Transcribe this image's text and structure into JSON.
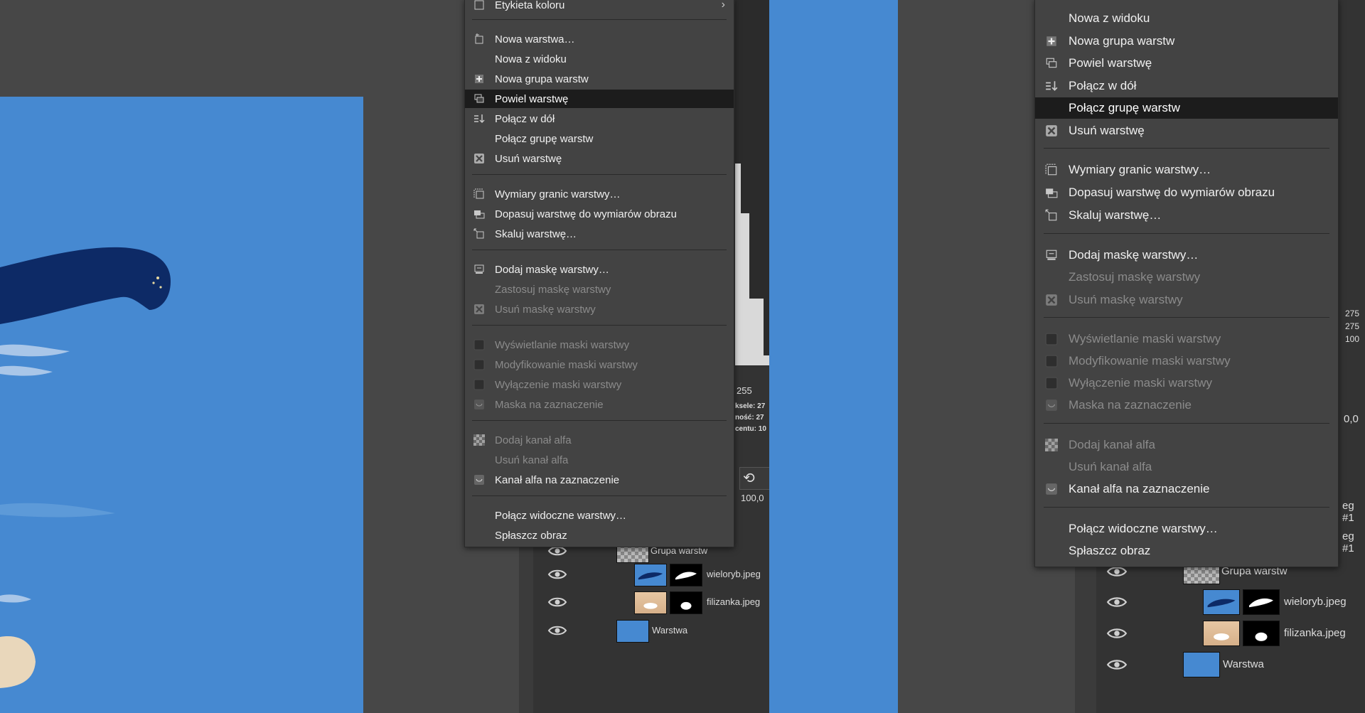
{
  "menu_left": {
    "items": [
      {
        "label": "Etykieta koloru",
        "icon": "color-tag-icon",
        "state": "normal",
        "submenu": true
      },
      {
        "label": "Nowa warstwa…",
        "icon": "new-layer-icon",
        "state": "normal"
      },
      {
        "label": "Nowa z widoku",
        "icon": "",
        "state": "normal"
      },
      {
        "label": "Nowa grupa warstw",
        "icon": "new-group-icon",
        "state": "normal"
      },
      {
        "label": "Powiel warstwę",
        "icon": "duplicate-icon",
        "state": "highlighted"
      },
      {
        "label": "Połącz w dół",
        "icon": "merge-down-icon",
        "state": "normal"
      },
      {
        "label": "Połącz grupę warstw",
        "icon": "",
        "state": "normal"
      },
      {
        "label": "Usuń warstwę",
        "icon": "delete-icon",
        "state": "normal"
      },
      {
        "label": "Wymiary granic warstwy…",
        "icon": "boundary-size-icon",
        "state": "normal"
      },
      {
        "label": "Dopasuj warstwę do wymiarów obrazu",
        "icon": "layer-to-image-icon",
        "state": "normal"
      },
      {
        "label": "Skaluj warstwę…",
        "icon": "scale-layer-icon",
        "state": "normal"
      },
      {
        "label": "Dodaj maskę warstwy…",
        "icon": "add-mask-icon",
        "state": "normal"
      },
      {
        "label": "Zastosuj maskę warstwy",
        "icon": "",
        "state": "disabled"
      },
      {
        "label": "Usuń maskę warstwy",
        "icon": "delete-icon",
        "state": "disabled"
      },
      {
        "label": "Wyświetlanie maski warstwy",
        "icon": "checkbox",
        "state": "disabled"
      },
      {
        "label": "Modyfikowanie maski warstwy",
        "icon": "checkbox",
        "state": "disabled"
      },
      {
        "label": "Wyłączenie maski warstwy",
        "icon": "checkbox",
        "state": "disabled"
      },
      {
        "label": "Maska na zaznaczenie",
        "icon": "mask-selection-icon",
        "state": "disabled"
      },
      {
        "label": "Dodaj kanał alfa",
        "icon": "alpha-icon",
        "state": "disabled"
      },
      {
        "label": "Usuń kanał alfa",
        "icon": "",
        "state": "disabled"
      },
      {
        "label": "Kanał alfa na zaznaczenie",
        "icon": "mask-selection-icon",
        "state": "normal"
      },
      {
        "label": "Połącz widoczne warstwy…",
        "icon": "",
        "state": "normal"
      },
      {
        "label": "Spłaszcz obraz",
        "icon": "",
        "state": "normal"
      }
    ]
  },
  "menu_right": {
    "items": [
      {
        "label": "Nowa z widoku",
        "icon": "",
        "state": "normal"
      },
      {
        "label": "Nowa grupa warstw",
        "icon": "new-group-icon",
        "state": "normal"
      },
      {
        "label": "Powiel warstwę",
        "icon": "duplicate-icon",
        "state": "normal"
      },
      {
        "label": "Połącz w dół",
        "icon": "merge-down-icon",
        "state": "normal"
      },
      {
        "label": "Połącz grupę warstw",
        "icon": "",
        "state": "highlighted"
      },
      {
        "label": "Usuń warstwę",
        "icon": "delete-icon",
        "state": "normal"
      },
      {
        "label": "Wymiary granic warstwy…",
        "icon": "boundary-size-icon",
        "state": "normal"
      },
      {
        "label": "Dopasuj warstwę do wymiarów obrazu",
        "icon": "layer-to-image-icon",
        "state": "normal"
      },
      {
        "label": "Skaluj warstwę…",
        "icon": "scale-layer-icon",
        "state": "normal"
      },
      {
        "label": "Dodaj maskę warstwy…",
        "icon": "add-mask-icon",
        "state": "normal"
      },
      {
        "label": "Zastosuj maskę warstwy",
        "icon": "",
        "state": "disabled"
      },
      {
        "label": "Usuń maskę warstwy",
        "icon": "delete-icon",
        "state": "disabled"
      },
      {
        "label": "Wyświetlanie maski warstwy",
        "icon": "checkbox",
        "state": "disabled"
      },
      {
        "label": "Modyfikowanie maski warstwy",
        "icon": "checkbox",
        "state": "disabled"
      },
      {
        "label": "Wyłączenie maski warstwy",
        "icon": "checkbox",
        "state": "disabled"
      },
      {
        "label": "Maska na zaznaczenie",
        "icon": "mask-selection-icon",
        "state": "disabled"
      },
      {
        "label": "Dodaj kanał alfa",
        "icon": "alpha-icon",
        "state": "disabled"
      },
      {
        "label": "Usuń kanał alfa",
        "icon": "",
        "state": "disabled"
      },
      {
        "label": "Kanał alfa na zaznaczenie",
        "icon": "mask-selection-icon",
        "state": "normal"
      },
      {
        "label": "Połącz widoczne warstwy…",
        "icon": "",
        "state": "normal"
      },
      {
        "label": "Spłaszcz obraz",
        "icon": "",
        "state": "normal"
      }
    ]
  },
  "histogram": {
    "max_value": "255"
  },
  "pointer_info": {
    "label_1": "ksele:",
    "value_1": "27",
    "label_2": "ność:",
    "value_2": "27",
    "label_3": "centu:",
    "value_3": "10"
  },
  "pointer_info_right": {
    "value_1": "275",
    "value_2": "275",
    "value_3": "100"
  },
  "opacity_left": "100,0",
  "opacity_right": "0,0",
  "layers_left": [
    {
      "name": "Grupa warstw",
      "kind": "group"
    },
    {
      "name": "wieloryb.jpeg",
      "kind": "whale"
    },
    {
      "name": "filizanka.jpeg",
      "kind": "cup"
    },
    {
      "name": "Warstwa",
      "kind": "solid"
    }
  ],
  "layers_right": [
    {
      "name": "Grupa warstw",
      "kind": "group"
    },
    {
      "name": "wieloryb.jpeg",
      "kind": "whale"
    },
    {
      "name": "filizanka.jpeg",
      "kind": "cup"
    },
    {
      "name": "Warstwa",
      "kind": "solid"
    }
  ],
  "right_edge_labels": [
    "eg #1",
    "eg #1"
  ],
  "colors": {
    "canvas_blue": "#4689d1",
    "menu_bg": "#434343",
    "highlight": "#1c1c1c",
    "whale_navy": "#0d2a66"
  }
}
